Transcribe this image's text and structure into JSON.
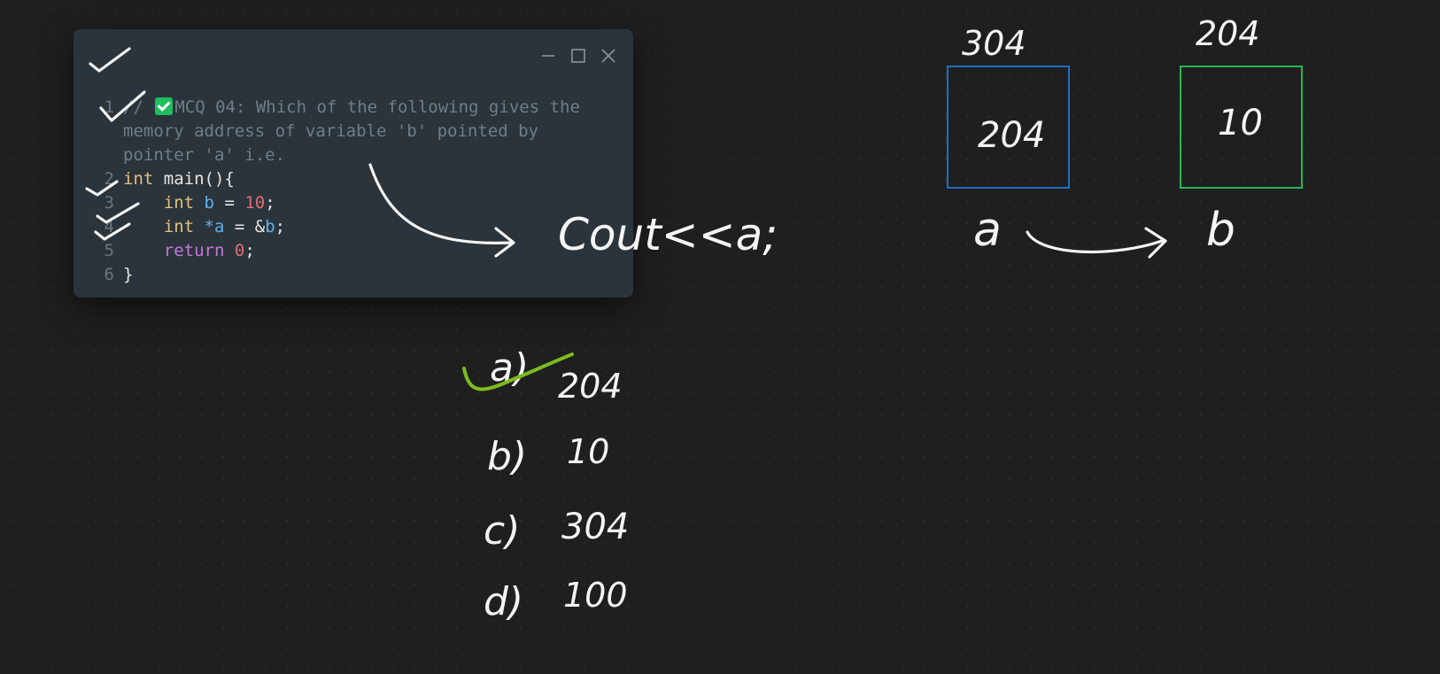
{
  "code_window": {
    "controls": [
      "minimize-icon",
      "maximize-icon",
      "close-icon"
    ],
    "lines": [
      {
        "num": "1",
        "comment_prefix": "// ",
        "comment_emoji": "check-mark-button-icon",
        "comment_text": "MCQ 04: Which of the following gives the memory address of variable 'b' pointed by pointer 'a' i.e."
      },
      {
        "num": "2",
        "kw": "int",
        "rest": " main(){"
      },
      {
        "num": "3",
        "indent": "    ",
        "kw": "int",
        "var": "b",
        "op": " = ",
        "num_val": "10",
        "end": ";"
      },
      {
        "num": "4",
        "indent": "    ",
        "kw": "int",
        "ptr": "*a",
        "op": " = &",
        "var": "b",
        "end": ";"
      },
      {
        "num": "5",
        "indent": "    ",
        "ret": "return",
        "num_val": "0",
        "end": ";"
      },
      {
        "num": "6",
        "rest": "}"
      }
    ]
  },
  "annotations": {
    "cout_text": "Cout<<a;",
    "box_a_address": "304",
    "box_a_value": "204",
    "box_a_label": "a",
    "box_b_address": "204",
    "box_b_value": "10",
    "box_b_label": "b",
    "options": [
      {
        "label": "a)",
        "value": "204",
        "marked": true
      },
      {
        "label": "b)",
        "value": "10",
        "marked": false
      },
      {
        "label": "c)",
        "value": "304",
        "marked": false
      },
      {
        "label": "d)",
        "value": "100",
        "marked": false
      }
    ]
  },
  "colors": {
    "canvas": "#1f1f1f",
    "window": "#2b343b",
    "box_a_border": "#1f6fc0",
    "box_b_border": "#1fb955",
    "highlight_check": "#7dbb1e",
    "ink": "#f4f4f4"
  }
}
